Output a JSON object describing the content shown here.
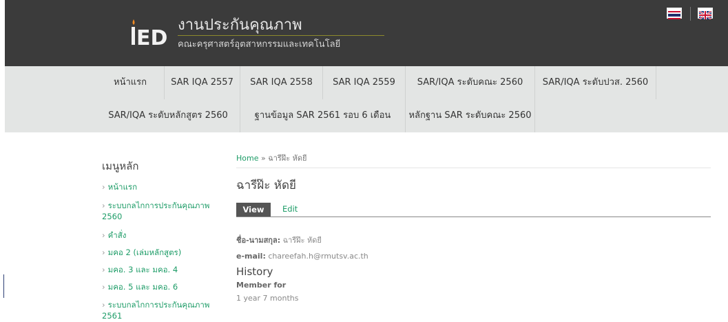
{
  "header": {
    "logo_text": "iED",
    "title": "งานประกันคุณภาพ",
    "subtitle": "คณะครุศาสตร์อุตสาหกรรมและเทคโนโลยี",
    "flags": [
      "thai-flag-icon",
      "uk-flag-icon"
    ]
  },
  "nav": {
    "row1": [
      "หน้าแรก",
      "SAR IQA 2557",
      "SAR IQA 2558",
      "SAR IQA 2559",
      "SAR/IQA ระดับคณะ 2560",
      "SAR/IQA ระดับปวส. 2560"
    ],
    "row2": [
      "SAR/IQA ระดับหลักสูตร 2560",
      "ฐานข้อมูล SAR 2561 รอบ 6 เดือน",
      "หลักฐาน SAR ระดับคณะ 2560"
    ]
  },
  "sidebar": {
    "title": "เมนูหลัก",
    "items": [
      {
        "line1": "หน้าแรก"
      },
      {
        "line1": "ระบบกลไกการประกันคุณภาพ",
        "line2": "2560"
      },
      {
        "line1": "คำสั่ง"
      },
      {
        "line1": "มคอ 2 (เล่มหลักสูตร)"
      },
      {
        "line1": "มคอ. 3 และ มคอ. 4"
      },
      {
        "line1": "มคอ. 5 และ มคอ. 6"
      },
      {
        "line1": "ระบบกลไกการประกันคุณภาพ",
        "line2": "2561"
      }
    ]
  },
  "content": {
    "breadcrumb_home": "Home",
    "breadcrumb_sep": "»",
    "breadcrumb_current": "ฉารีฝ๊ะ หัดยี",
    "title": "ฉารีฝ๊ะ หัดยี",
    "tabs": {
      "view": "View",
      "edit": "Edit"
    },
    "name_label": "ชื่อ-นามสกุล:",
    "name_value": "ฉารีฝ๊ะ หัดยี",
    "email_label": "e-mail:",
    "email_value": "chareefah.h@rmutsv.ac.th",
    "history_title": "History",
    "member_label": "Member for",
    "member_value": "1 year 7 months"
  },
  "colors": {
    "header_bg": "#3b3b3b",
    "nav_bg": "#e3e5e4",
    "link": "#1d9c67",
    "accent_line": "#8d8a2c"
  }
}
